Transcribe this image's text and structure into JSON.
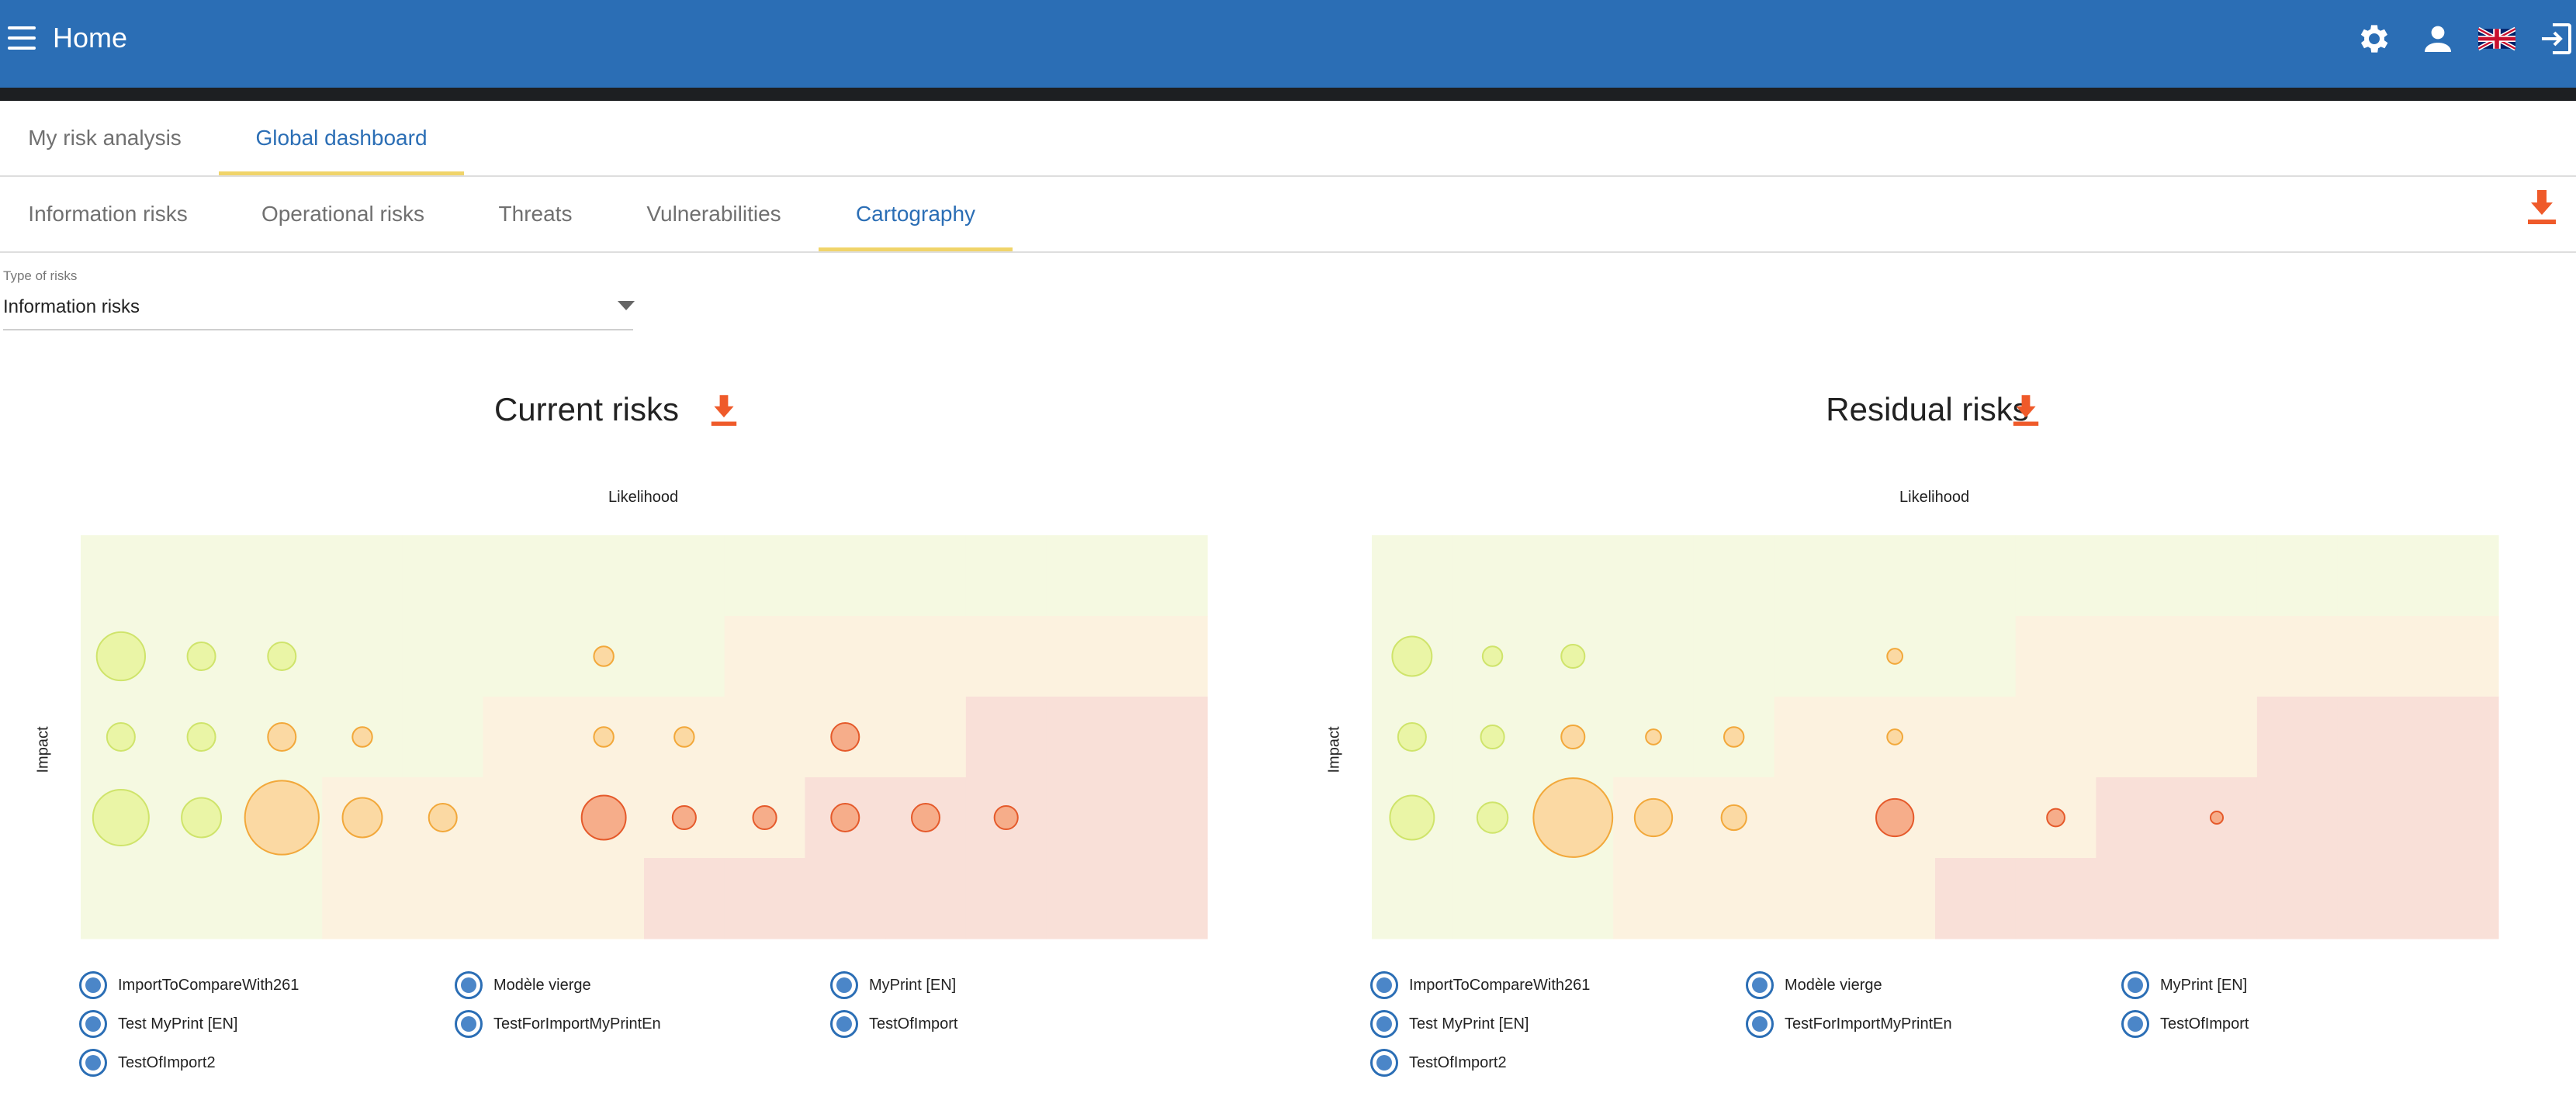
{
  "appbar": {
    "title": "Home",
    "icons": [
      "menu-icon",
      "gear-icon",
      "user-icon",
      "uk-flag-icon",
      "logout-icon"
    ],
    "color": "#2b6eb5"
  },
  "main_tabs": [
    {
      "label": "My risk analysis",
      "active": false
    },
    {
      "label": "Global dashboard",
      "active": true
    }
  ],
  "sub_tabs": [
    {
      "label": "Information risks",
      "active": false
    },
    {
      "label": "Operational risks",
      "active": false
    },
    {
      "label": "Threats",
      "active": false
    },
    {
      "label": "Vulnerabilities",
      "active": false
    },
    {
      "label": "Cartography",
      "active": true
    }
  ],
  "type_select": {
    "label": "Type of risks",
    "value": "Information risks"
  },
  "accent_colors": {
    "download": "#ef5a2a",
    "tab_underline": "#f0d46a",
    "legend": "#2b6eb5"
  },
  "chart_data": [
    {
      "type": "scatter",
      "title": "Current risks",
      "xlabel": "Likelihood",
      "ylabel": "Impact",
      "grid": {
        "columns": 14,
        "rows": 5
      },
      "zones": {
        "colors": {
          "low": "#f5f9e1",
          "medium": "#fcf2df",
          "high": "#f9e0d8"
        },
        "rows": [
          [
            "low",
            "low",
            "low",
            "low",
            "low",
            "low",
            "low",
            "low",
            "low",
            "low",
            "low",
            "low",
            "low",
            "low"
          ],
          [
            "low",
            "low",
            "low",
            "low",
            "low",
            "low",
            "low",
            "low",
            "medium",
            "medium",
            "medium",
            "medium",
            "medium",
            "medium"
          ],
          [
            "low",
            "low",
            "low",
            "low",
            "low",
            "medium",
            "medium",
            "medium",
            "medium",
            "medium",
            "medium",
            "high",
            "high",
            "high"
          ],
          [
            "low",
            "low",
            "low",
            "medium",
            "medium",
            "medium",
            "medium",
            "medium",
            "medium",
            "high",
            "high",
            "high",
            "high",
            "high"
          ],
          [
            "low",
            "low",
            "low",
            "medium",
            "medium",
            "medium",
            "medium",
            "high",
            "high",
            "high",
            "high",
            "high",
            "high",
            "high"
          ]
        ]
      },
      "points": [
        {
          "likelihood": 1,
          "impact": 2,
          "size": 3
        },
        {
          "likelihood": 2,
          "impact": 2,
          "size": 1
        },
        {
          "likelihood": 3,
          "impact": 2,
          "size": 1
        },
        {
          "likelihood": 7,
          "impact": 2,
          "size": 0.5
        },
        {
          "likelihood": 1,
          "impact": 3,
          "size": 1
        },
        {
          "likelihood": 2,
          "impact": 3,
          "size": 1
        },
        {
          "likelihood": 3,
          "impact": 3,
          "size": 1
        },
        {
          "likelihood": 4,
          "impact": 3,
          "size": 0.5
        },
        {
          "likelihood": 7,
          "impact": 3,
          "size": 0.5
        },
        {
          "likelihood": 8,
          "impact": 3,
          "size": 0.5
        },
        {
          "likelihood": 10,
          "impact": 3,
          "size": 1
        },
        {
          "likelihood": 1,
          "impact": 4,
          "size": 4
        },
        {
          "likelihood": 2,
          "impact": 4,
          "size": 2
        },
        {
          "likelihood": 3,
          "impact": 4,
          "size": 7
        },
        {
          "likelihood": 4,
          "impact": 4,
          "size": 2
        },
        {
          "likelihood": 5,
          "impact": 4,
          "size": 1
        },
        {
          "likelihood": 7,
          "impact": 4,
          "size": 2.5
        },
        {
          "likelihood": 8,
          "impact": 4,
          "size": 0.7
        },
        {
          "likelihood": 9,
          "impact": 4,
          "size": 0.7
        },
        {
          "likelihood": 10,
          "impact": 4,
          "size": 1
        },
        {
          "likelihood": 11,
          "impact": 4,
          "size": 1
        },
        {
          "likelihood": 12,
          "impact": 4,
          "size": 0.7
        }
      ],
      "legend": [
        "ImportToCompareWith261",
        "Modèle vierge",
        "MyPrint [EN]",
        "Test MyPrint [EN]",
        "TestForImportMyPrintEn",
        "TestOfImport",
        "TestOfImport2"
      ]
    },
    {
      "type": "scatter",
      "title": "Residual risks",
      "xlabel": "Likelihood",
      "ylabel": "Impact",
      "grid": {
        "columns": 14,
        "rows": 5
      },
      "zones": {
        "colors": {
          "low": "#f5f9e1",
          "medium": "#fcf2df",
          "high": "#f9e0d8"
        },
        "rows": [
          [
            "low",
            "low",
            "low",
            "low",
            "low",
            "low",
            "low",
            "low",
            "low",
            "low",
            "low",
            "low",
            "low",
            "low"
          ],
          [
            "low",
            "low",
            "low",
            "low",
            "low",
            "low",
            "low",
            "low",
            "medium",
            "medium",
            "medium",
            "medium",
            "medium",
            "medium"
          ],
          [
            "low",
            "low",
            "low",
            "low",
            "low",
            "medium",
            "medium",
            "medium",
            "medium",
            "medium",
            "medium",
            "high",
            "high",
            "high"
          ],
          [
            "low",
            "low",
            "low",
            "medium",
            "medium",
            "medium",
            "medium",
            "medium",
            "medium",
            "high",
            "high",
            "high",
            "high",
            "high"
          ],
          [
            "low",
            "low",
            "low",
            "medium",
            "medium",
            "medium",
            "medium",
            "high",
            "high",
            "high",
            "high",
            "high",
            "high",
            "high"
          ]
        ]
      },
      "points": [
        {
          "likelihood": 1,
          "impact": 2,
          "size": 2
        },
        {
          "likelihood": 2,
          "impact": 2,
          "size": 0.5
        },
        {
          "likelihood": 3,
          "impact": 2,
          "size": 0.7
        },
        {
          "likelihood": 7,
          "impact": 2,
          "size": 0.3
        },
        {
          "likelihood": 1,
          "impact": 3,
          "size": 1
        },
        {
          "likelihood": 2,
          "impact": 3,
          "size": 0.7
        },
        {
          "likelihood": 3,
          "impact": 3,
          "size": 0.7
        },
        {
          "likelihood": 4,
          "impact": 3,
          "size": 0.3
        },
        {
          "likelihood": 5,
          "impact": 3,
          "size": 0.5
        },
        {
          "likelihood": 7,
          "impact": 3,
          "size": 0.3
        },
        {
          "likelihood": 1,
          "impact": 4,
          "size": 2.5
        },
        {
          "likelihood": 2,
          "impact": 4,
          "size": 1.2
        },
        {
          "likelihood": 3,
          "impact": 4,
          "size": 8
        },
        {
          "likelihood": 4,
          "impact": 4,
          "size": 1.8
        },
        {
          "likelihood": 5,
          "impact": 4,
          "size": 0.8
        },
        {
          "likelihood": 7,
          "impact": 4,
          "size": 1.8
        },
        {
          "likelihood": 9,
          "impact": 4,
          "size": 0.4
        },
        {
          "likelihood": 11,
          "impact": 4,
          "size": 0.2
        }
      ],
      "legend": [
        "ImportToCompareWith261",
        "Modèle vierge",
        "MyPrint [EN]",
        "Test MyPrint [EN]",
        "TestForImportMyPrintEn",
        "TestOfImport",
        "TestOfImport2"
      ]
    }
  ]
}
